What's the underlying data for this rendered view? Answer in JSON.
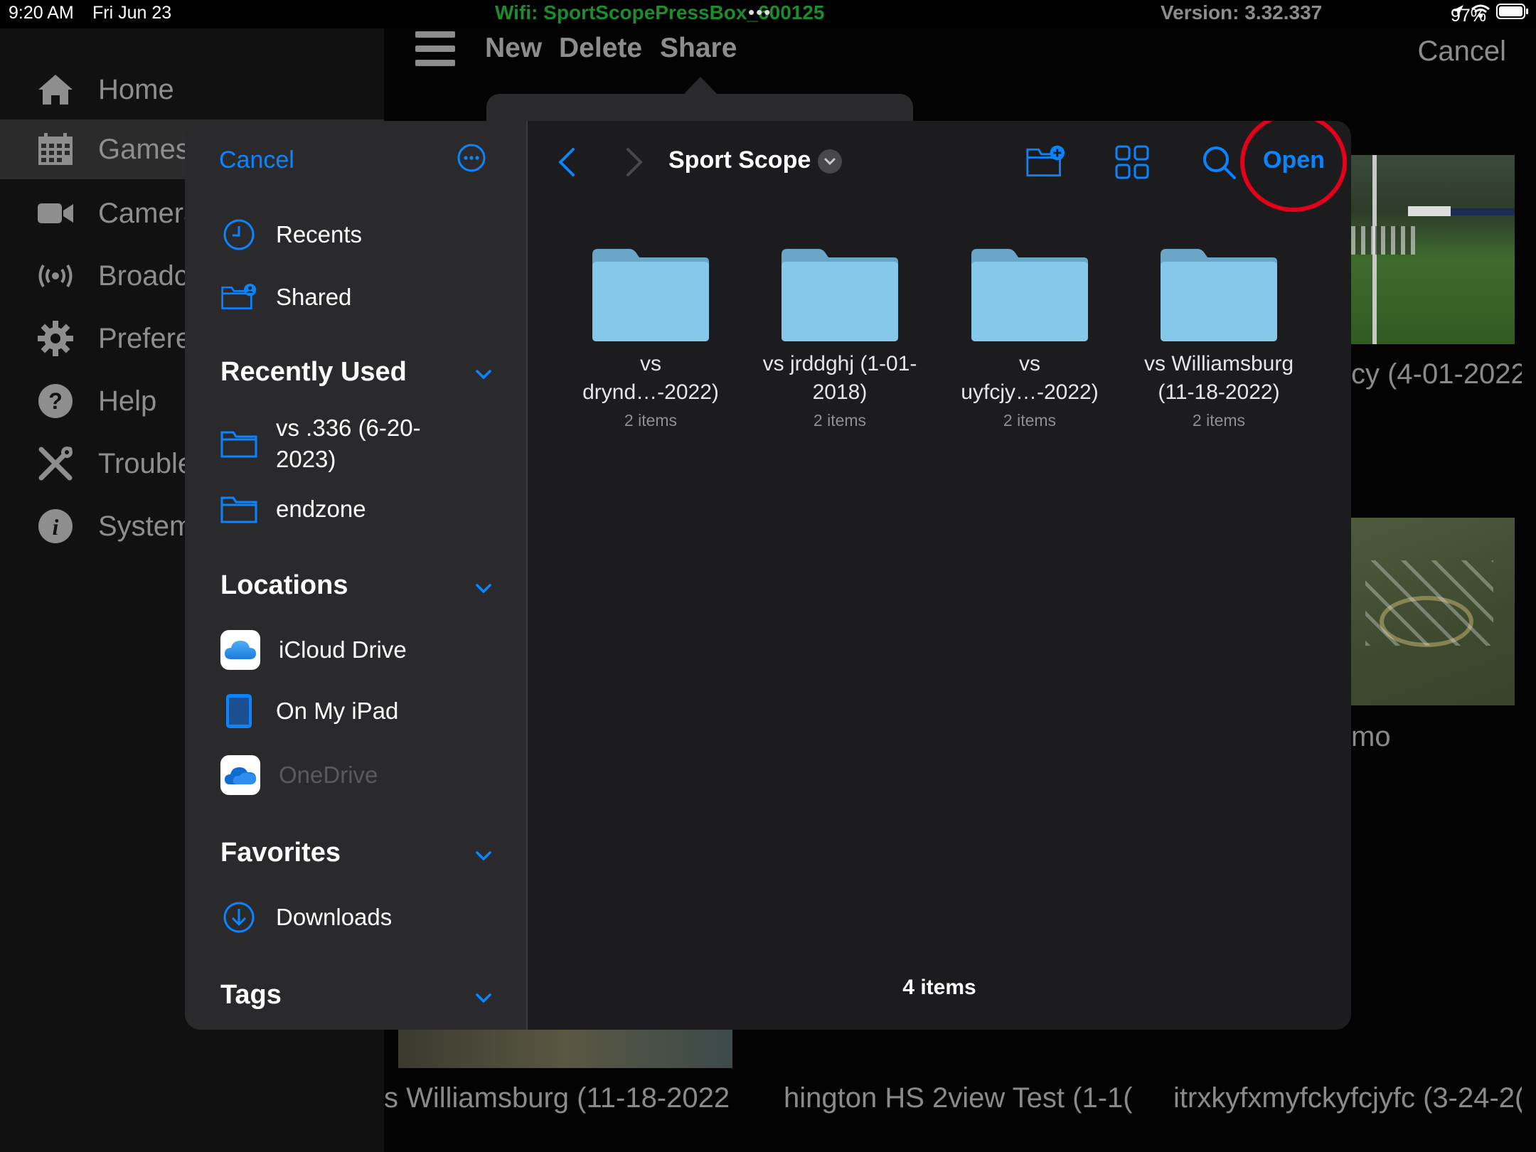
{
  "status_bar": {
    "time": "9:20 AM",
    "date": "Fri Jun 23",
    "wifi": "Wifi: SportScopePressBox_600125",
    "dots": "•••",
    "version": "Version: 3.32.337",
    "battery": "97%"
  },
  "app": {
    "sidebar": [
      {
        "label": "Home",
        "icon": "home-icon"
      },
      {
        "label": "Games",
        "icon": "calendar-icon"
      },
      {
        "label": "Camera",
        "icon": "video-camera-icon"
      },
      {
        "label": "Broadcast",
        "icon": "broadcast-icon"
      },
      {
        "label": "Preferences",
        "icon": "gear-icon"
      },
      {
        "label": "Help",
        "icon": "help-icon"
      },
      {
        "label": "Troubleshoot",
        "icon": "tools-icon"
      },
      {
        "label": "System",
        "icon": "info-icon"
      }
    ],
    "toolbar": {
      "new": "New",
      "delete": "Delete",
      "share": "Share",
      "cancel": "Cancel"
    },
    "captions": {
      "right_top": "cy (4-01-2022",
      "right_mid": "mo",
      "bottom_1": "s Williamsburg (11-18-2022",
      "bottom_2": "hington HS 2view Test (1-1(",
      "bottom_3": "itrxkyfxmyfckyfcjyfc (3-24-2("
    }
  },
  "picker": {
    "cancel": "Cancel",
    "recents": "Recents",
    "shared": "Shared",
    "recently_used": {
      "title": "Recently Used",
      "items": [
        "vs .336 (6-20-2023)",
        "endzone"
      ]
    },
    "locations": {
      "title": "Locations",
      "items": [
        "iCloud Drive",
        "On My iPad",
        "OneDrive"
      ]
    },
    "favorites": {
      "title": "Favorites",
      "items": [
        "Downloads"
      ]
    },
    "tags": {
      "title": "Tags"
    },
    "location_title": "Sport Scope",
    "open": "Open",
    "folders": [
      {
        "name": "vs drynd…-2022)",
        "count": "2 items"
      },
      {
        "name": "vs jrddghj (1-01-2018)",
        "count": "2 items"
      },
      {
        "name": "vs uyfcjy…-2022)",
        "count": "2 items"
      },
      {
        "name": "vs Williamsburg (11-18-2022)",
        "count": "2 items"
      }
    ],
    "item_count": "4 items"
  },
  "colors": {
    "accent": "#0a84ff",
    "annotation": "#e3001b",
    "wifi": "#1e8c2e"
  }
}
